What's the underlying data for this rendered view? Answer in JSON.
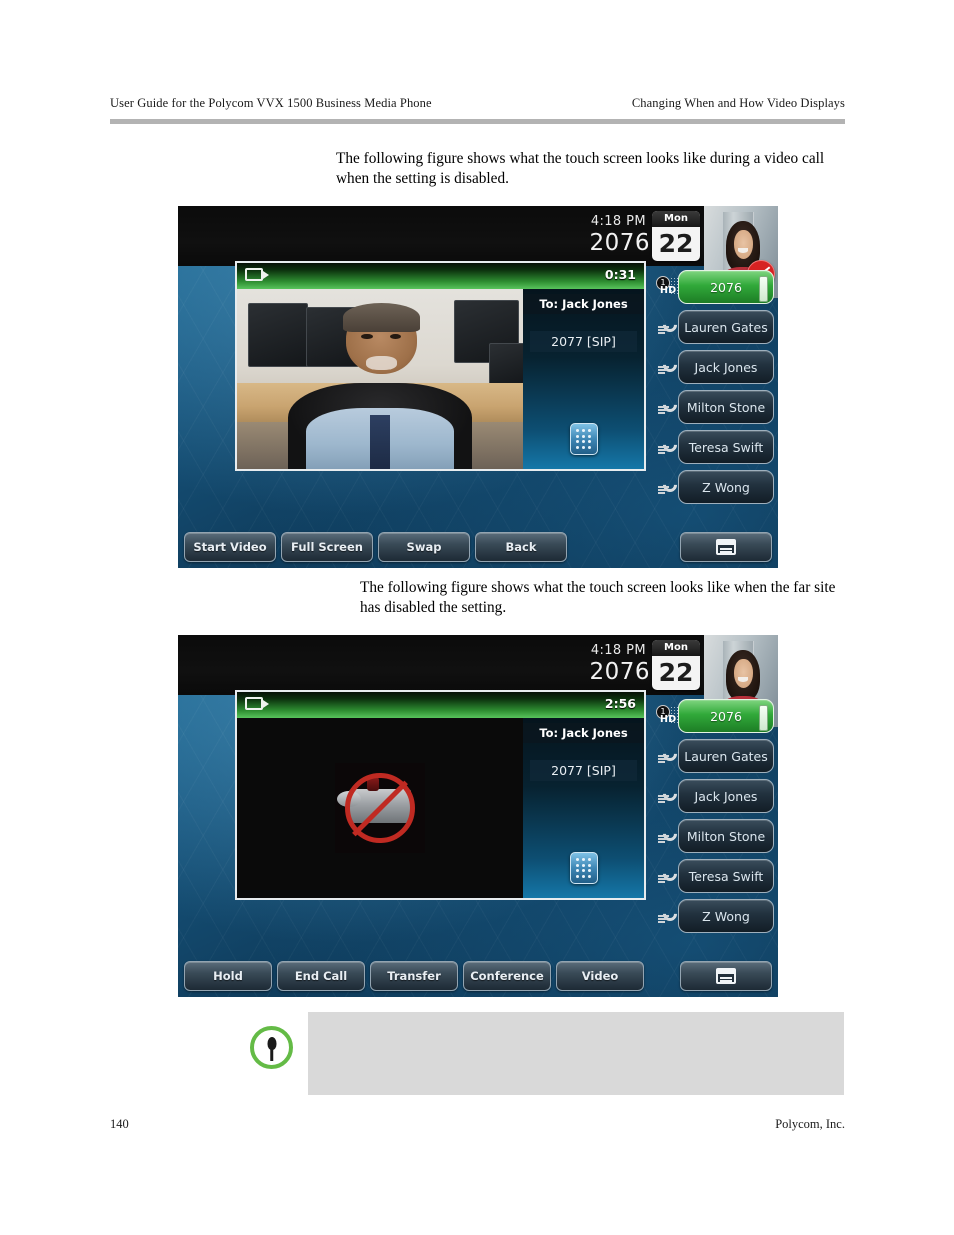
{
  "header": {
    "left": "User Guide for the Polycom VVX 1500 Business Media Phone",
    "right": "Changing When and How Video Displays"
  },
  "paragraphs": {
    "p1": "The following figure shows what the touch screen looks like during a video call when the setting is disabled.",
    "p2": "The following figure shows what the touch screen looks like when the far site has disabled the setting."
  },
  "figure1": {
    "status": {
      "time": "4:18 PM",
      "extension": "2076",
      "day_of_week": "Mon",
      "day_number": "22",
      "selfview_badge_icon": "camera-off-icon"
    },
    "call": {
      "video_icon": "video-camera-icon",
      "timer": "0:31",
      "to_label": "To: Jack Jones",
      "remote_number": "2077 [SIP]",
      "keypad_icon": "dialpad-icon"
    },
    "line_keys": [
      {
        "label": "2076",
        "active": true,
        "badge": "1",
        "hd": "HD"
      },
      {
        "label": "Lauren Gates",
        "active": false,
        "icon": "handset-icon"
      },
      {
        "label": "Jack Jones",
        "active": false,
        "icon": "handset-icon"
      },
      {
        "label": "Milton Stone",
        "active": false,
        "icon": "handset-icon"
      },
      {
        "label": "Teresa Swift",
        "active": false,
        "icon": "handset-icon"
      },
      {
        "label": "Z Wong",
        "active": false,
        "icon": "handset-icon"
      }
    ],
    "softkeys": [
      "Start Video",
      "Full Screen",
      "Swap",
      "Back"
    ],
    "menu_key_icon": "menu-window-icon"
  },
  "figure2": {
    "status": {
      "time": "4:18 PM",
      "extension": "2076",
      "day_of_week": "Mon",
      "day_number": "22",
      "selfview_badge_icon": "camera-off-icon"
    },
    "call": {
      "video_icon": "video-camera-icon",
      "timer": "2:56",
      "to_label": "To: Jack Jones",
      "remote_number": "2077 [SIP]",
      "keypad_icon": "dialpad-icon",
      "video_placeholder_icon": "no-video-camera-icon"
    },
    "line_keys": [
      {
        "label": "2076",
        "active": true,
        "badge": "1",
        "hd": "HD"
      },
      {
        "label": "Lauren Gates",
        "active": false,
        "icon": "handset-icon"
      },
      {
        "label": "Jack Jones",
        "active": false,
        "icon": "handset-icon"
      },
      {
        "label": "Milton Stone",
        "active": false,
        "icon": "handset-icon"
      },
      {
        "label": "Teresa Swift",
        "active": false,
        "icon": "handset-icon"
      },
      {
        "label": "Z Wong",
        "active": false,
        "icon": "handset-icon"
      }
    ],
    "softkeys": [
      "Hold",
      "End Call",
      "Transfer",
      "Conference",
      "Video"
    ],
    "menu_key_icon": "menu-window-icon"
  },
  "note": {
    "icon": "note-pin-icon",
    "text": ""
  },
  "footer": {
    "page_number": "140",
    "company": "Polycom, Inc."
  },
  "colors": {
    "accent_green": "#64bb46",
    "rule_grey": "#b3b3b3",
    "note_bg": "#d9d9d9",
    "line_key_active": "#31a93a",
    "badge_red": "#d62222"
  }
}
